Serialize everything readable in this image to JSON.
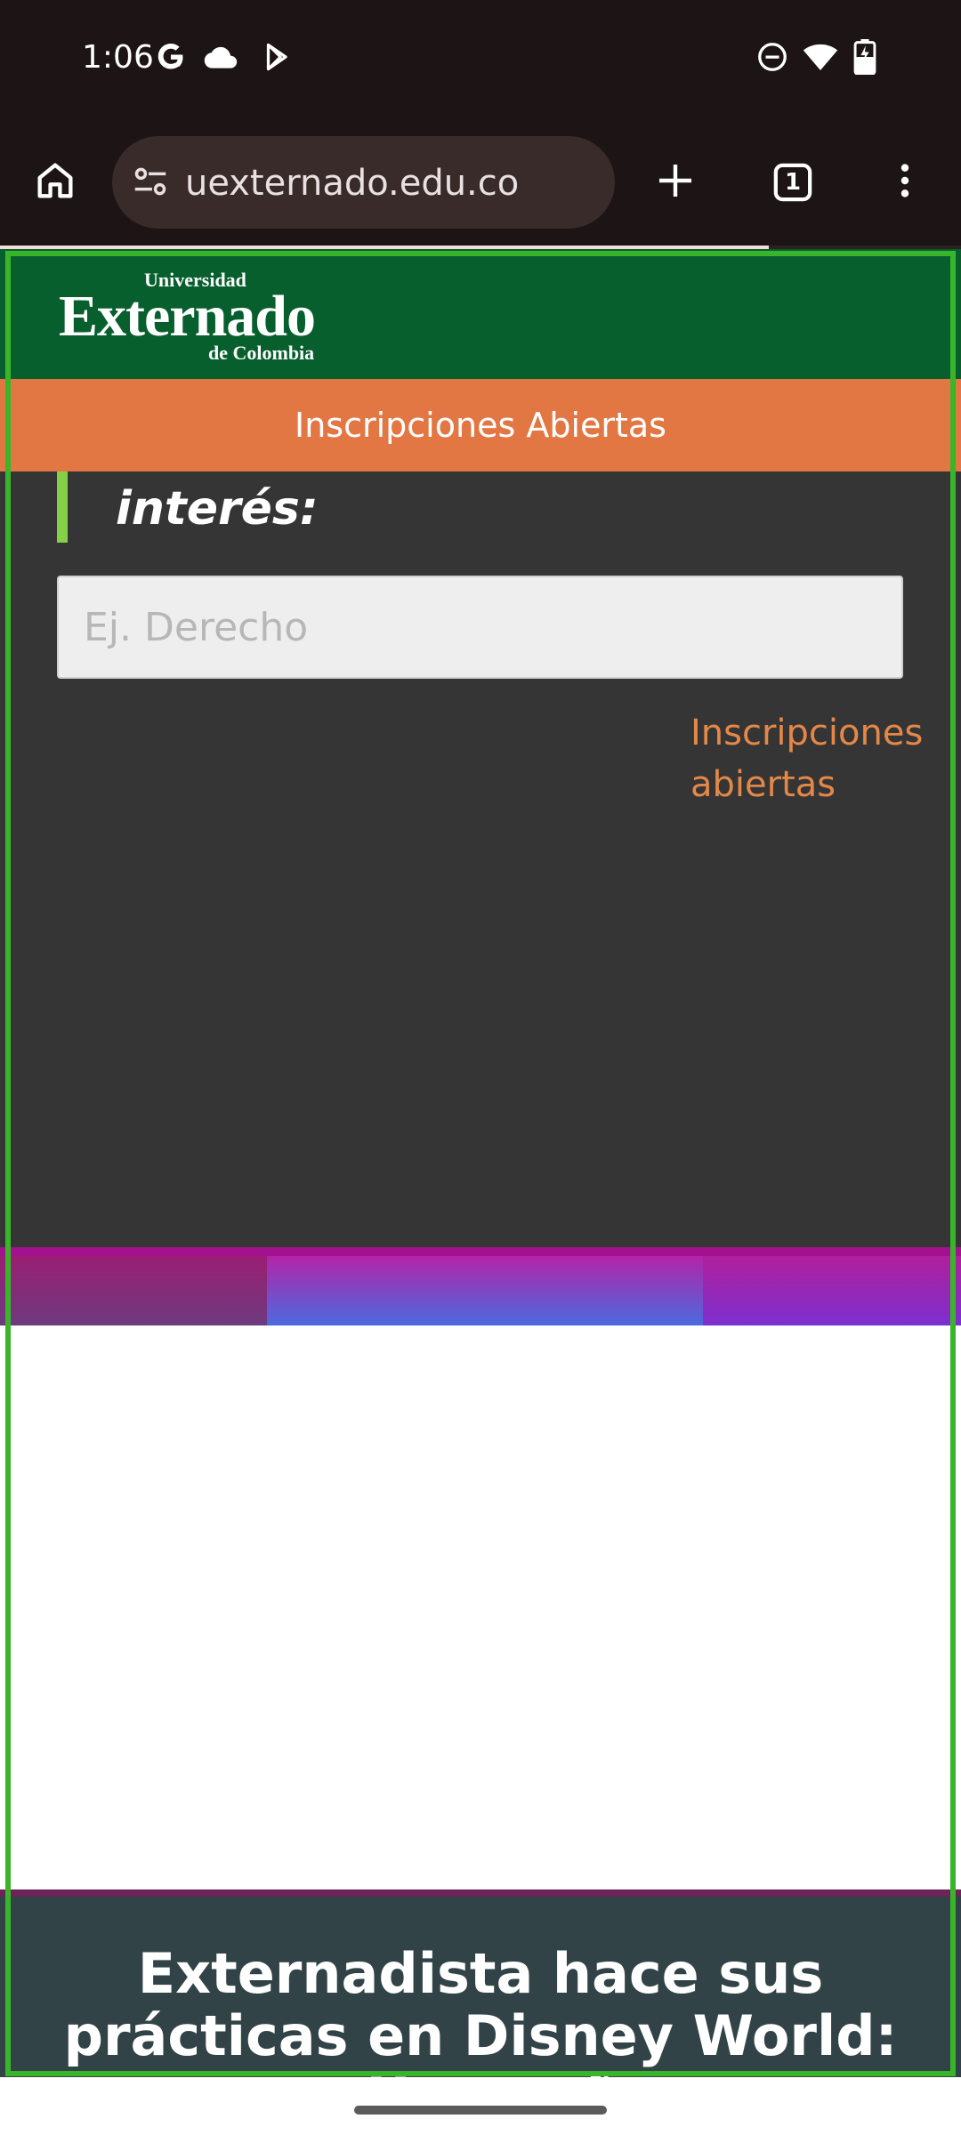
{
  "status_bar": {
    "time": "1:06",
    "left_icons": [
      "google-g-icon",
      "cloud-icon",
      "play-store-icon"
    ],
    "right_icons": [
      "do-not-disturb-icon",
      "wifi-icon",
      "battery-charging-icon"
    ]
  },
  "browser": {
    "url": "uexternado.edu.co",
    "tab_count": "1",
    "icons": {
      "home": "home-icon",
      "site_settings": "tune-icon",
      "new_tab": "plus-icon",
      "tabs": "tab-switcher-icon",
      "menu": "more-vert-icon"
    },
    "load_progress": 0.8
  },
  "site": {
    "logo": {
      "top": "Universidad",
      "main": "Externado",
      "bottom": "de Colombia"
    },
    "banner_text": "Inscripciones Abiertas",
    "heading_partial": "interés:",
    "search_placeholder": "Ej. Derecho",
    "inscripciones_link": "Inscripciones abiertas",
    "news_title": "Externadista hace sus prácticas en Disney World: «¡Un sueño",
    "colors": {
      "header_green": "#075f2d",
      "banner_orange": "#e37744",
      "link_orange": "#e48849",
      "accent_green": "#86d049",
      "content_dark": "#353535",
      "news_bg": "#324347"
    }
  }
}
